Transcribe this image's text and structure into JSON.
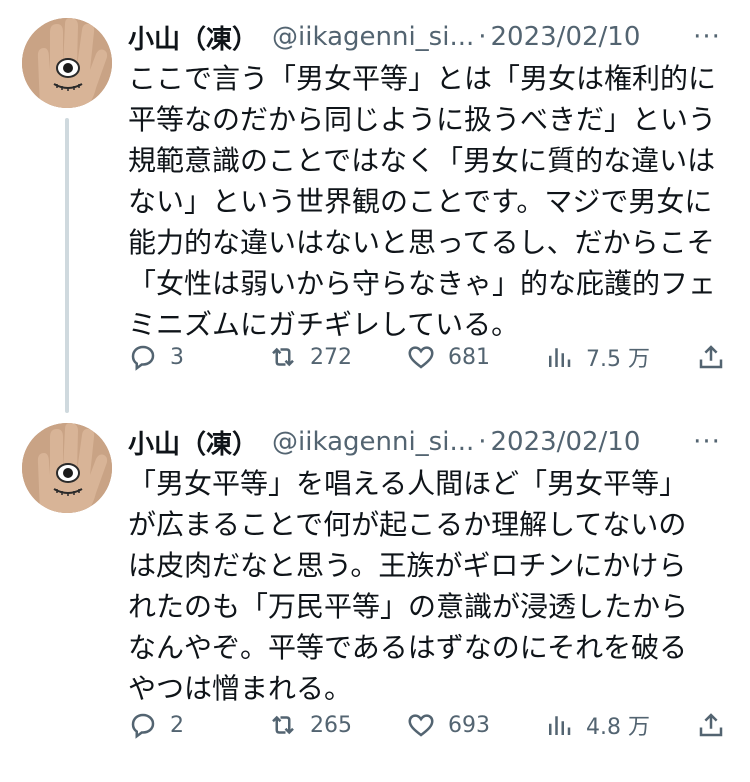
{
  "tweets": [
    {
      "name": "小山（凍）",
      "handle": "@iikagenni_si...",
      "separator": "·",
      "date": "2023/02/10",
      "more_label": "···",
      "lines": [
        "ここで言う「男女平等」とは「男女は権利的に",
        "平等なのだから同じように扱うべきだ」という",
        "規範意識のことではなく「男女に質的な違いは",
        "ない」という世界観のことです。マジで男女に",
        "能力的な違いはないと思ってるし、だからこそ",
        "「女性は弱いから守らなきゃ」的な庇護的フェ",
        "ミニズムにガチギレしている。"
      ],
      "stats": {
        "replies": "3",
        "retweets": "272",
        "likes": "681",
        "views": "7.5 万"
      }
    },
    {
      "name": "小山（凍）",
      "handle": "@iikagenni_si...",
      "separator": "·",
      "date": "2023/02/10",
      "more_label": "···",
      "lines": [
        "「男女平等」を唱える人間ほど「男女平等」",
        "が広まることで何が起こるか理解してないの",
        "は皮肉だなと思う。王族がギロチンにかけら",
        "れたのも「万民平等」の意識が浸透したから",
        "なんやぞ。平等であるはずなのにそれを破る",
        "やつは憎まれる。"
      ],
      "stats": {
        "replies": "2",
        "retweets": "265",
        "likes": "693",
        "views": "4.8 万"
      }
    }
  ]
}
